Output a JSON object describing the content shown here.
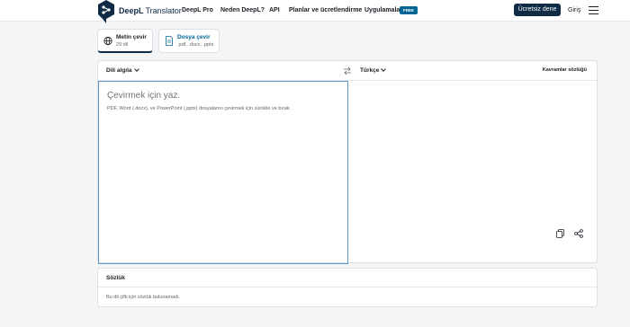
{
  "header": {
    "brand_name": "DeepL",
    "brand_sub": "Translator",
    "nav": [
      "DeepL Pro",
      "Neden DeepL?",
      "API",
      "Planlar ve ücretlendirme",
      "Uygulamalar"
    ],
    "apps_badge": "FREE",
    "cta_label": "Ücretsiz dene",
    "login_label": "Giriş",
    "menu_icon": "hamburger-icon"
  },
  "tabs": [
    {
      "title": "Metin çevir",
      "subtitle": "29 dil",
      "icon": "globe-icon",
      "active": true
    },
    {
      "title": "Dosya çevir",
      "subtitle": ".pdf, .docx, .pptx",
      "icon": "document-icon",
      "active": false
    }
  ],
  "translator": {
    "source_lang": "Dili algıla",
    "target_lang": "Türkçe",
    "glossary_label": "Kavramlar sözlüğü",
    "source_placeholder": "Çevirmek için yaz.",
    "source_hint": "PDF, Word (.docx), ve PowerPoint (.pptx) dosyalarını çevirmek için sürükle ve bırak."
  },
  "dictionary": {
    "title": "Sözlük",
    "message": "Bu dil çifti için sözlük bulunamadı."
  },
  "colors": {
    "brand_navy": "#0f2b46",
    "badge_blue": "#006494",
    "focus_border": "#5d97c7",
    "background": "#f3f5f6"
  }
}
